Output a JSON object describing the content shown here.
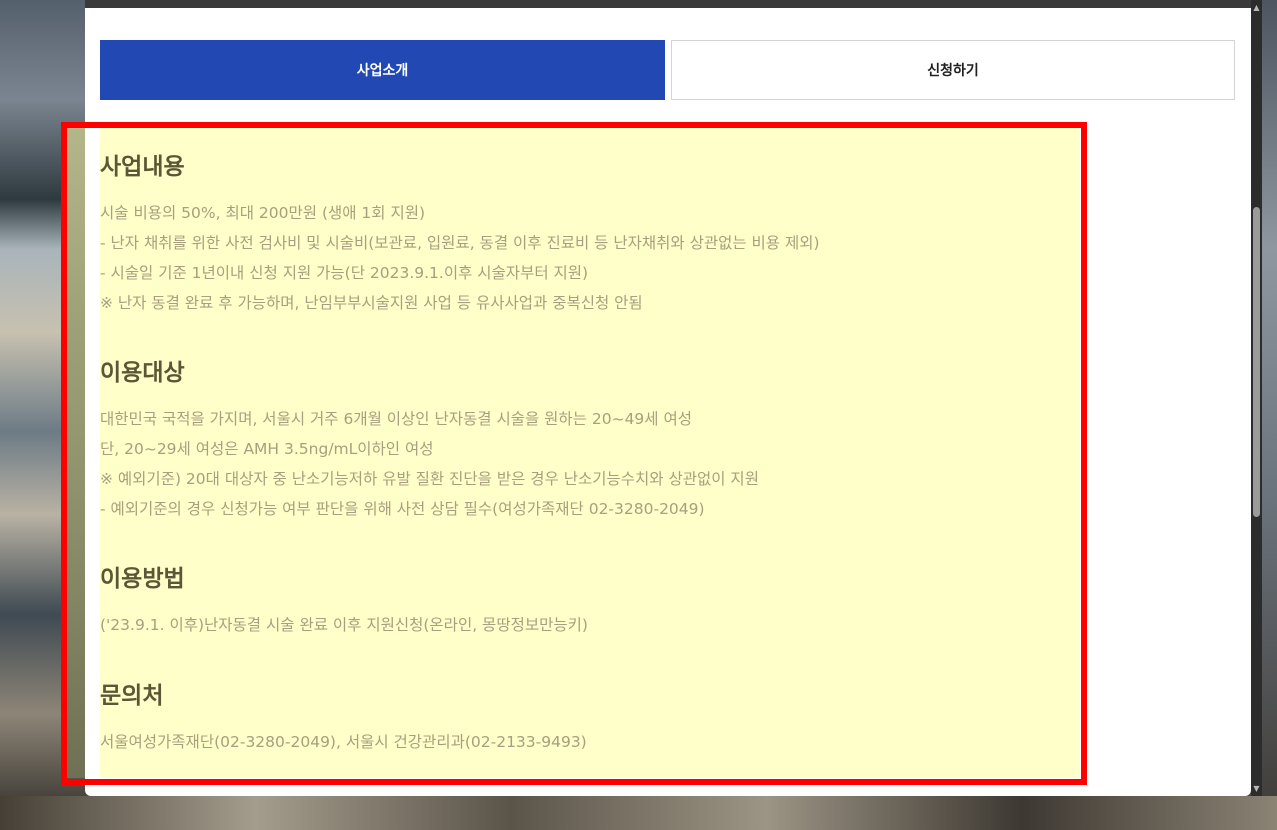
{
  "tabs": {
    "intro": "사업소개",
    "apply": "신청하기"
  },
  "sections": [
    {
      "title": "사업내용",
      "lines": [
        "시술 비용의 50%, 최대 200만원 (생애 1회 지원)",
        "- 난자 채취를 위한 사전 검사비 및 시술비(보관료, 입원료, 동결 이후 진료비 등 난자채취와 상관없는 비용 제외)",
        "- 시술일 기준 1년이내 신청 지원 가능(단 2023.9.1.이후 시술자부터 지원)",
        "※ 난자 동결  완료 후 가능하며, 난임부부시술지원 사업 등 유사사업과 중복신청 안됨"
      ]
    },
    {
      "title": "이용대상",
      "lines": [
        "대한민국 국적을 가지며, 서울시 거주 6개월 이상인 난자동결 시술을 원하는 20~49세 여성",
        "단, 20~29세 여성은 AMH 3.5ng/mL이하인 여성",
        "※ 예외기준) 20대 대상자 중 난소기능저하 유발 질환 진단을 받은 경우 난소기능수치와 상관없이 지원",
        "- 예외기준의 경우 신청가능 여부 판단을 위해 사전 상담 필수(여성가족재단 02-3280-2049)"
      ]
    },
    {
      "title": "이용방법",
      "lines": [
        "('23.9.1. 이후)난자동결 시술 완료 이후 지원신청(온라인, 몽땅정보만능키)"
      ]
    },
    {
      "title": "문의처",
      "lines": [
        "서울여성가족재단(02-3280-2049), 서울시 건강관리과(02-2133-9493)"
      ]
    }
  ],
  "colors": {
    "active_tab": "#2249b3",
    "content_bg": "#ffffca",
    "highlight_border": "#ff0000"
  }
}
